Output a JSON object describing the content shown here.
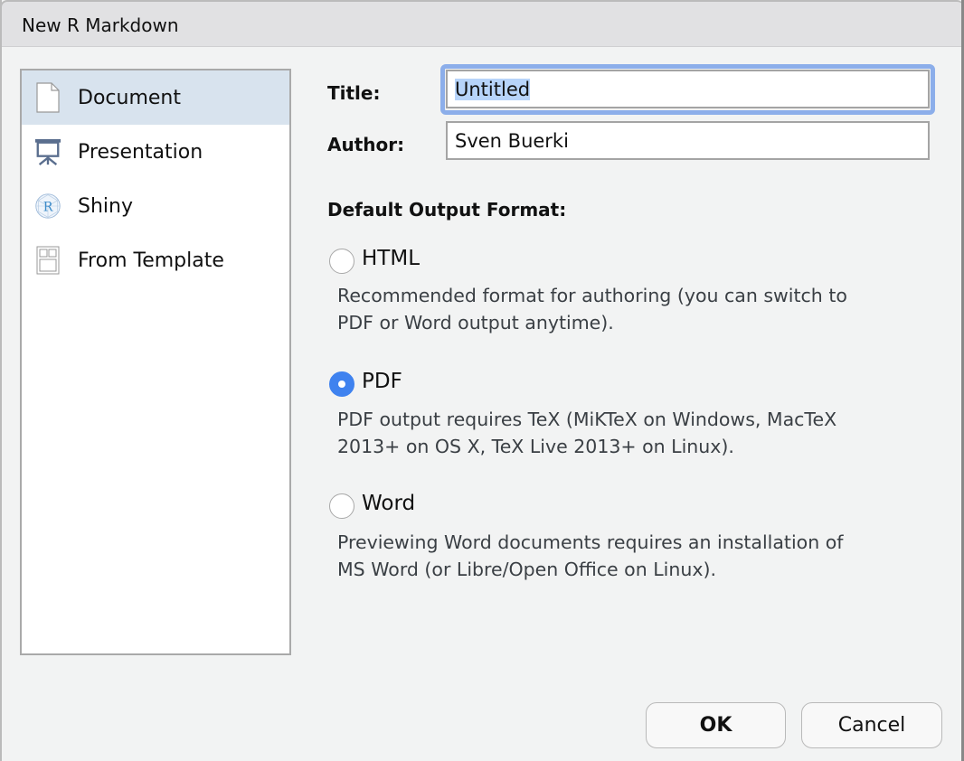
{
  "window": {
    "title": "New R Markdown"
  },
  "sidebar": {
    "items": [
      {
        "label": "Document",
        "icon": "document-icon",
        "selected": true
      },
      {
        "label": "Presentation",
        "icon": "presentation-easel-icon",
        "selected": false
      },
      {
        "label": "Shiny",
        "icon": "shiny-r-icon",
        "selected": false
      },
      {
        "label": "From Template",
        "icon": "template-icon",
        "selected": false
      }
    ]
  },
  "form": {
    "title_label": "Title:",
    "title_value": "Untitled",
    "author_label": "Author:",
    "author_value": "Sven Buerki",
    "format_heading": "Default Output Format:",
    "options": [
      {
        "label": "HTML",
        "checked": false,
        "desc1": "Recommended format for authoring (you can switch to",
        "desc2": "PDF or Word output anytime)."
      },
      {
        "label": "PDF",
        "checked": true,
        "desc1": "PDF output requires TeX (MiKTeX on Windows, MacTeX",
        "desc2": "2013+ on OS X, TeX Live 2013+ on Linux)."
      },
      {
        "label": "Word",
        "checked": false,
        "desc1": "Previewing Word documents requires an installation of",
        "desc2": "MS Word (or Libre/Open Office on Linux)."
      }
    ]
  },
  "buttons": {
    "ok": "OK",
    "cancel": "Cancel"
  },
  "colors": {
    "accent": "#3f82ef",
    "focus_ring": "#8caeea",
    "selected_row": "#d8e3ee"
  }
}
